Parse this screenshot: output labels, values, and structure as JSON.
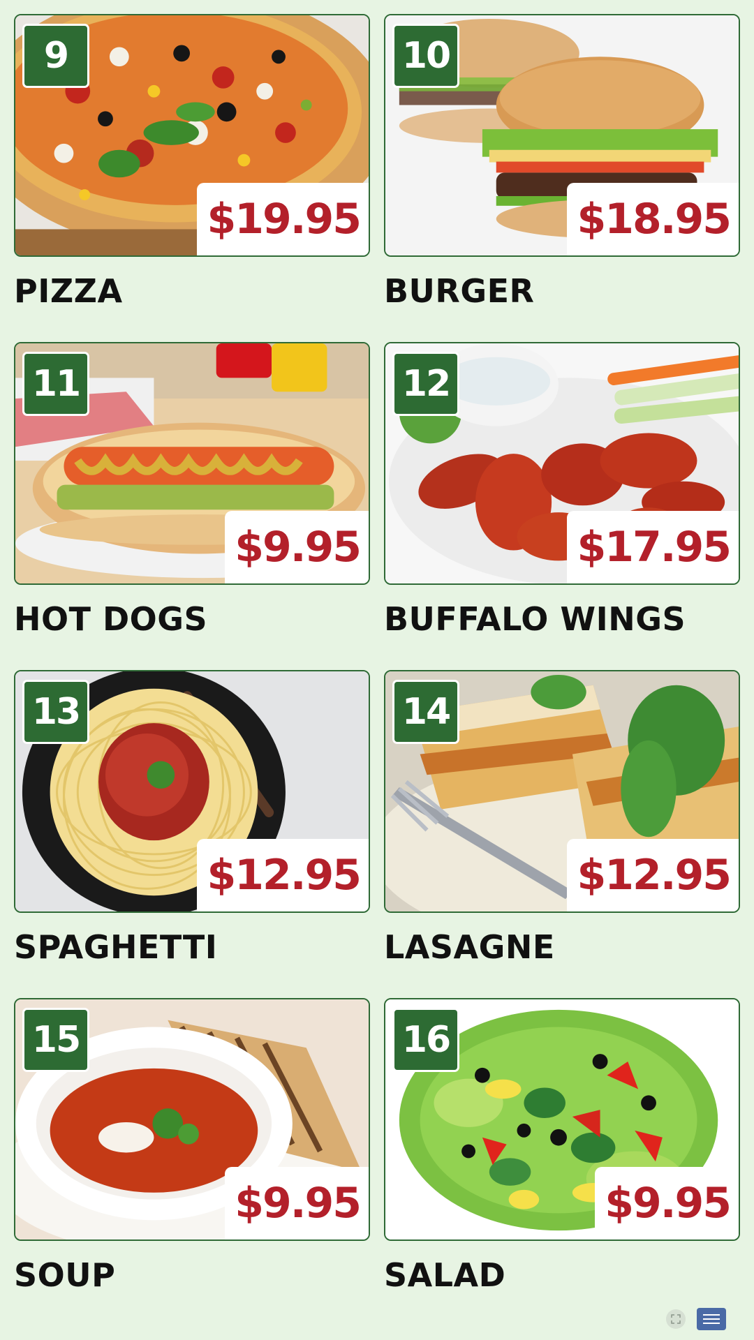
{
  "menu": {
    "items": [
      {
        "number": "9",
        "price": "$19.95",
        "name": "PIZZA",
        "image": "pizza"
      },
      {
        "number": "10",
        "price": "$18.95",
        "name": "BURGER",
        "image": "burger"
      },
      {
        "number": "11",
        "price": "$9.95",
        "name": "HOT DOGS",
        "image": "hot-dog"
      },
      {
        "number": "12",
        "price": "$17.95",
        "name": "BUFFALO WINGS",
        "image": "buffalo-wings"
      },
      {
        "number": "13",
        "price": "$12.95",
        "name": "SPAGHETTI",
        "image": "spaghetti"
      },
      {
        "number": "14",
        "price": "$12.95",
        "name": "LASAGNE",
        "image": "lasagne"
      },
      {
        "number": "15",
        "price": "$9.95",
        "name": "SOUP",
        "image": "soup"
      },
      {
        "number": "16",
        "price": "$9.95",
        "name": "SALAD",
        "image": "salad"
      }
    ]
  },
  "controls": {
    "fullscreen_icon": "fullscreen-icon",
    "menu_icon": "hamburger-menu-icon"
  },
  "colors": {
    "background": "#e7f4e3",
    "badge": "#2d6b33",
    "price_text": "#b3202a",
    "border": "#2f6a36"
  }
}
